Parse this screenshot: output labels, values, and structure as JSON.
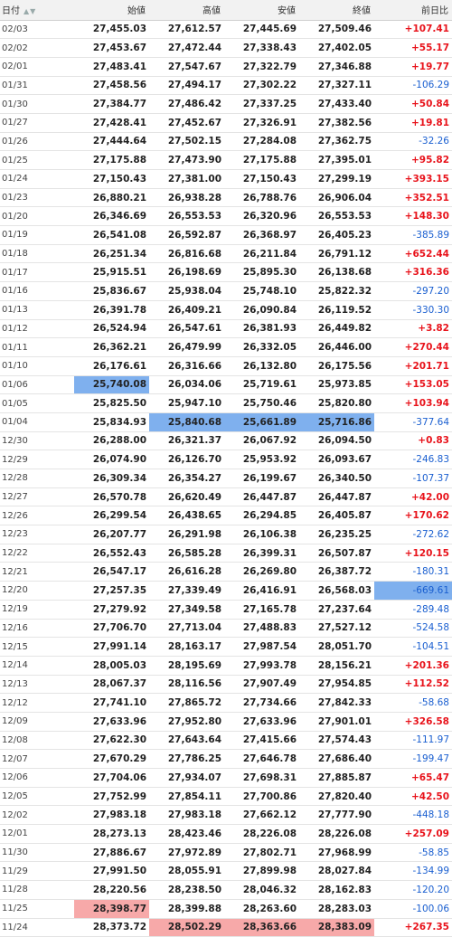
{
  "headers": [
    "日付",
    "始値",
    "高値",
    "安値",
    "終値",
    "前日比"
  ],
  "sort_icon": "sort-icon",
  "colors": {
    "up": "#e8131b",
    "down": "#1a5fd0",
    "highlight_low": "#7fb0ee",
    "highlight_high": "#f7a9a9"
  },
  "rows": [
    [
      "02/03",
      "27,455.03",
      "27,612.57",
      "27,445.69",
      "27,509.46",
      "+107.41"
    ],
    [
      "02/02",
      "27,453.67",
      "27,472.44",
      "27,338.43",
      "27,402.05",
      "+55.17"
    ],
    [
      "02/01",
      "27,483.41",
      "27,547.67",
      "27,322.79",
      "27,346.88",
      "+19.77"
    ],
    [
      "01/31",
      "27,458.56",
      "27,494.17",
      "27,302.22",
      "27,327.11",
      "-106.29"
    ],
    [
      "01/30",
      "27,384.77",
      "27,486.42",
      "27,337.25",
      "27,433.40",
      "+50.84"
    ],
    [
      "01/27",
      "27,428.41",
      "27,452.67",
      "27,326.91",
      "27,382.56",
      "+19.81"
    ],
    [
      "01/26",
      "27,444.64",
      "27,502.15",
      "27,284.08",
      "27,362.75",
      "-32.26"
    ],
    [
      "01/25",
      "27,175.88",
      "27,473.90",
      "27,175.88",
      "27,395.01",
      "+95.82"
    ],
    [
      "01/24",
      "27,150.43",
      "27,381.00",
      "27,150.43",
      "27,299.19",
      "+393.15"
    ],
    [
      "01/23",
      "26,880.21",
      "26,938.28",
      "26,788.76",
      "26,906.04",
      "+352.51"
    ],
    [
      "01/20",
      "26,346.69",
      "26,553.53",
      "26,320.96",
      "26,553.53",
      "+148.30"
    ],
    [
      "01/19",
      "26,541.08",
      "26,592.87",
      "26,368.97",
      "26,405.23",
      "-385.89"
    ],
    [
      "01/18",
      "26,251.34",
      "26,816.68",
      "26,211.84",
      "26,791.12",
      "+652.44"
    ],
    [
      "01/17",
      "25,915.51",
      "26,198.69",
      "25,895.30",
      "26,138.68",
      "+316.36"
    ],
    [
      "01/16",
      "25,836.67",
      "25,938.04",
      "25,748.10",
      "25,822.32",
      "-297.20"
    ],
    [
      "01/13",
      "26,391.78",
      "26,409.21",
      "26,090.84",
      "26,119.52",
      "-330.30"
    ],
    [
      "01/12",
      "26,524.94",
      "26,547.61",
      "26,381.93",
      "26,449.82",
      "+3.82"
    ],
    [
      "01/11",
      "26,362.21",
      "26,479.99",
      "26,332.05",
      "26,446.00",
      "+270.44"
    ],
    [
      "01/10",
      "26,176.61",
      "26,316.66",
      "26,132.80",
      "26,175.56",
      "+201.71"
    ],
    [
      "01/06",
      "25,740.08",
      "26,034.06",
      "25,719.61",
      "25,973.85",
      "+153.05"
    ],
    [
      "01/05",
      "25,825.50",
      "25,947.10",
      "25,750.46",
      "25,820.80",
      "+103.94"
    ],
    [
      "01/04",
      "25,834.93",
      "25,840.68",
      "25,661.89",
      "25,716.86",
      "-377.64"
    ],
    [
      "12/30",
      "26,288.00",
      "26,321.37",
      "26,067.92",
      "26,094.50",
      "+0.83"
    ],
    [
      "12/29",
      "26,074.90",
      "26,126.70",
      "25,953.92",
      "26,093.67",
      "-246.83"
    ],
    [
      "12/28",
      "26,309.34",
      "26,354.27",
      "26,199.67",
      "26,340.50",
      "-107.37"
    ],
    [
      "12/27",
      "26,570.78",
      "26,620.49",
      "26,447.87",
      "26,447.87",
      "+42.00"
    ],
    [
      "12/26",
      "26,299.54",
      "26,438.65",
      "26,294.85",
      "26,405.87",
      "+170.62"
    ],
    [
      "12/23",
      "26,207.77",
      "26,291.98",
      "26,106.38",
      "26,235.25",
      "-272.62"
    ],
    [
      "12/22",
      "26,552.43",
      "26,585.28",
      "26,399.31",
      "26,507.87",
      "+120.15"
    ],
    [
      "12/21",
      "26,547.17",
      "26,616.28",
      "26,269.80",
      "26,387.72",
      "-180.31"
    ],
    [
      "12/20",
      "27,257.35",
      "27,339.49",
      "26,416.91",
      "26,568.03",
      "-669.61"
    ],
    [
      "12/19",
      "27,279.92",
      "27,349.58",
      "27,165.78",
      "27,237.64",
      "-289.48"
    ],
    [
      "12/16",
      "27,706.70",
      "27,713.04",
      "27,488.83",
      "27,527.12",
      "-524.58"
    ],
    [
      "12/15",
      "27,991.14",
      "28,163.17",
      "27,987.54",
      "28,051.70",
      "-104.51"
    ],
    [
      "12/14",
      "28,005.03",
      "28,195.69",
      "27,993.78",
      "28,156.21",
      "+201.36"
    ],
    [
      "12/13",
      "28,067.37",
      "28,116.56",
      "27,907.49",
      "27,954.85",
      "+112.52"
    ],
    [
      "12/12",
      "27,741.10",
      "27,865.72",
      "27,734.66",
      "27,842.33",
      "-58.68"
    ],
    [
      "12/09",
      "27,633.96",
      "27,952.80",
      "27,633.96",
      "27,901.01",
      "+326.58"
    ],
    [
      "12/08",
      "27,622.30",
      "27,643.64",
      "27,415.66",
      "27,574.43",
      "-111.97"
    ],
    [
      "12/07",
      "27,670.29",
      "27,786.25",
      "27,646.78",
      "27,686.40",
      "-199.47"
    ],
    [
      "12/06",
      "27,704.06",
      "27,934.07",
      "27,698.31",
      "27,885.87",
      "+65.47"
    ],
    [
      "12/05",
      "27,752.99",
      "27,854.11",
      "27,700.86",
      "27,820.40",
      "+42.50"
    ],
    [
      "12/02",
      "27,983.18",
      "27,983.18",
      "27,662.12",
      "27,777.90",
      "-448.18"
    ],
    [
      "12/01",
      "28,273.13",
      "28,423.46",
      "28,226.08",
      "28,226.08",
      "+257.09"
    ],
    [
      "11/30",
      "27,886.67",
      "27,972.89",
      "27,802.71",
      "27,968.99",
      "-58.85"
    ],
    [
      "11/29",
      "27,991.50",
      "28,055.91",
      "27,899.98",
      "28,027.84",
      "-134.99"
    ],
    [
      "11/28",
      "28,220.56",
      "28,238.50",
      "28,046.32",
      "28,162.83",
      "-120.20"
    ],
    [
      "11/25",
      "28,398.77",
      "28,399.88",
      "28,263.60",
      "28,283.03",
      "-100.06"
    ],
    [
      "11/24",
      "28,373.72",
      "28,502.29",
      "28,363.66",
      "28,383.09",
      "+267.35"
    ]
  ],
  "highlights": {
    "low": [
      [
        19,
        1
      ],
      [
        21,
        2
      ],
      [
        21,
        3
      ],
      [
        21,
        4
      ],
      [
        30,
        5
      ]
    ],
    "high": [
      [
        47,
        1
      ],
      [
        48,
        2
      ],
      [
        48,
        3
      ],
      [
        48,
        4
      ]
    ]
  }
}
